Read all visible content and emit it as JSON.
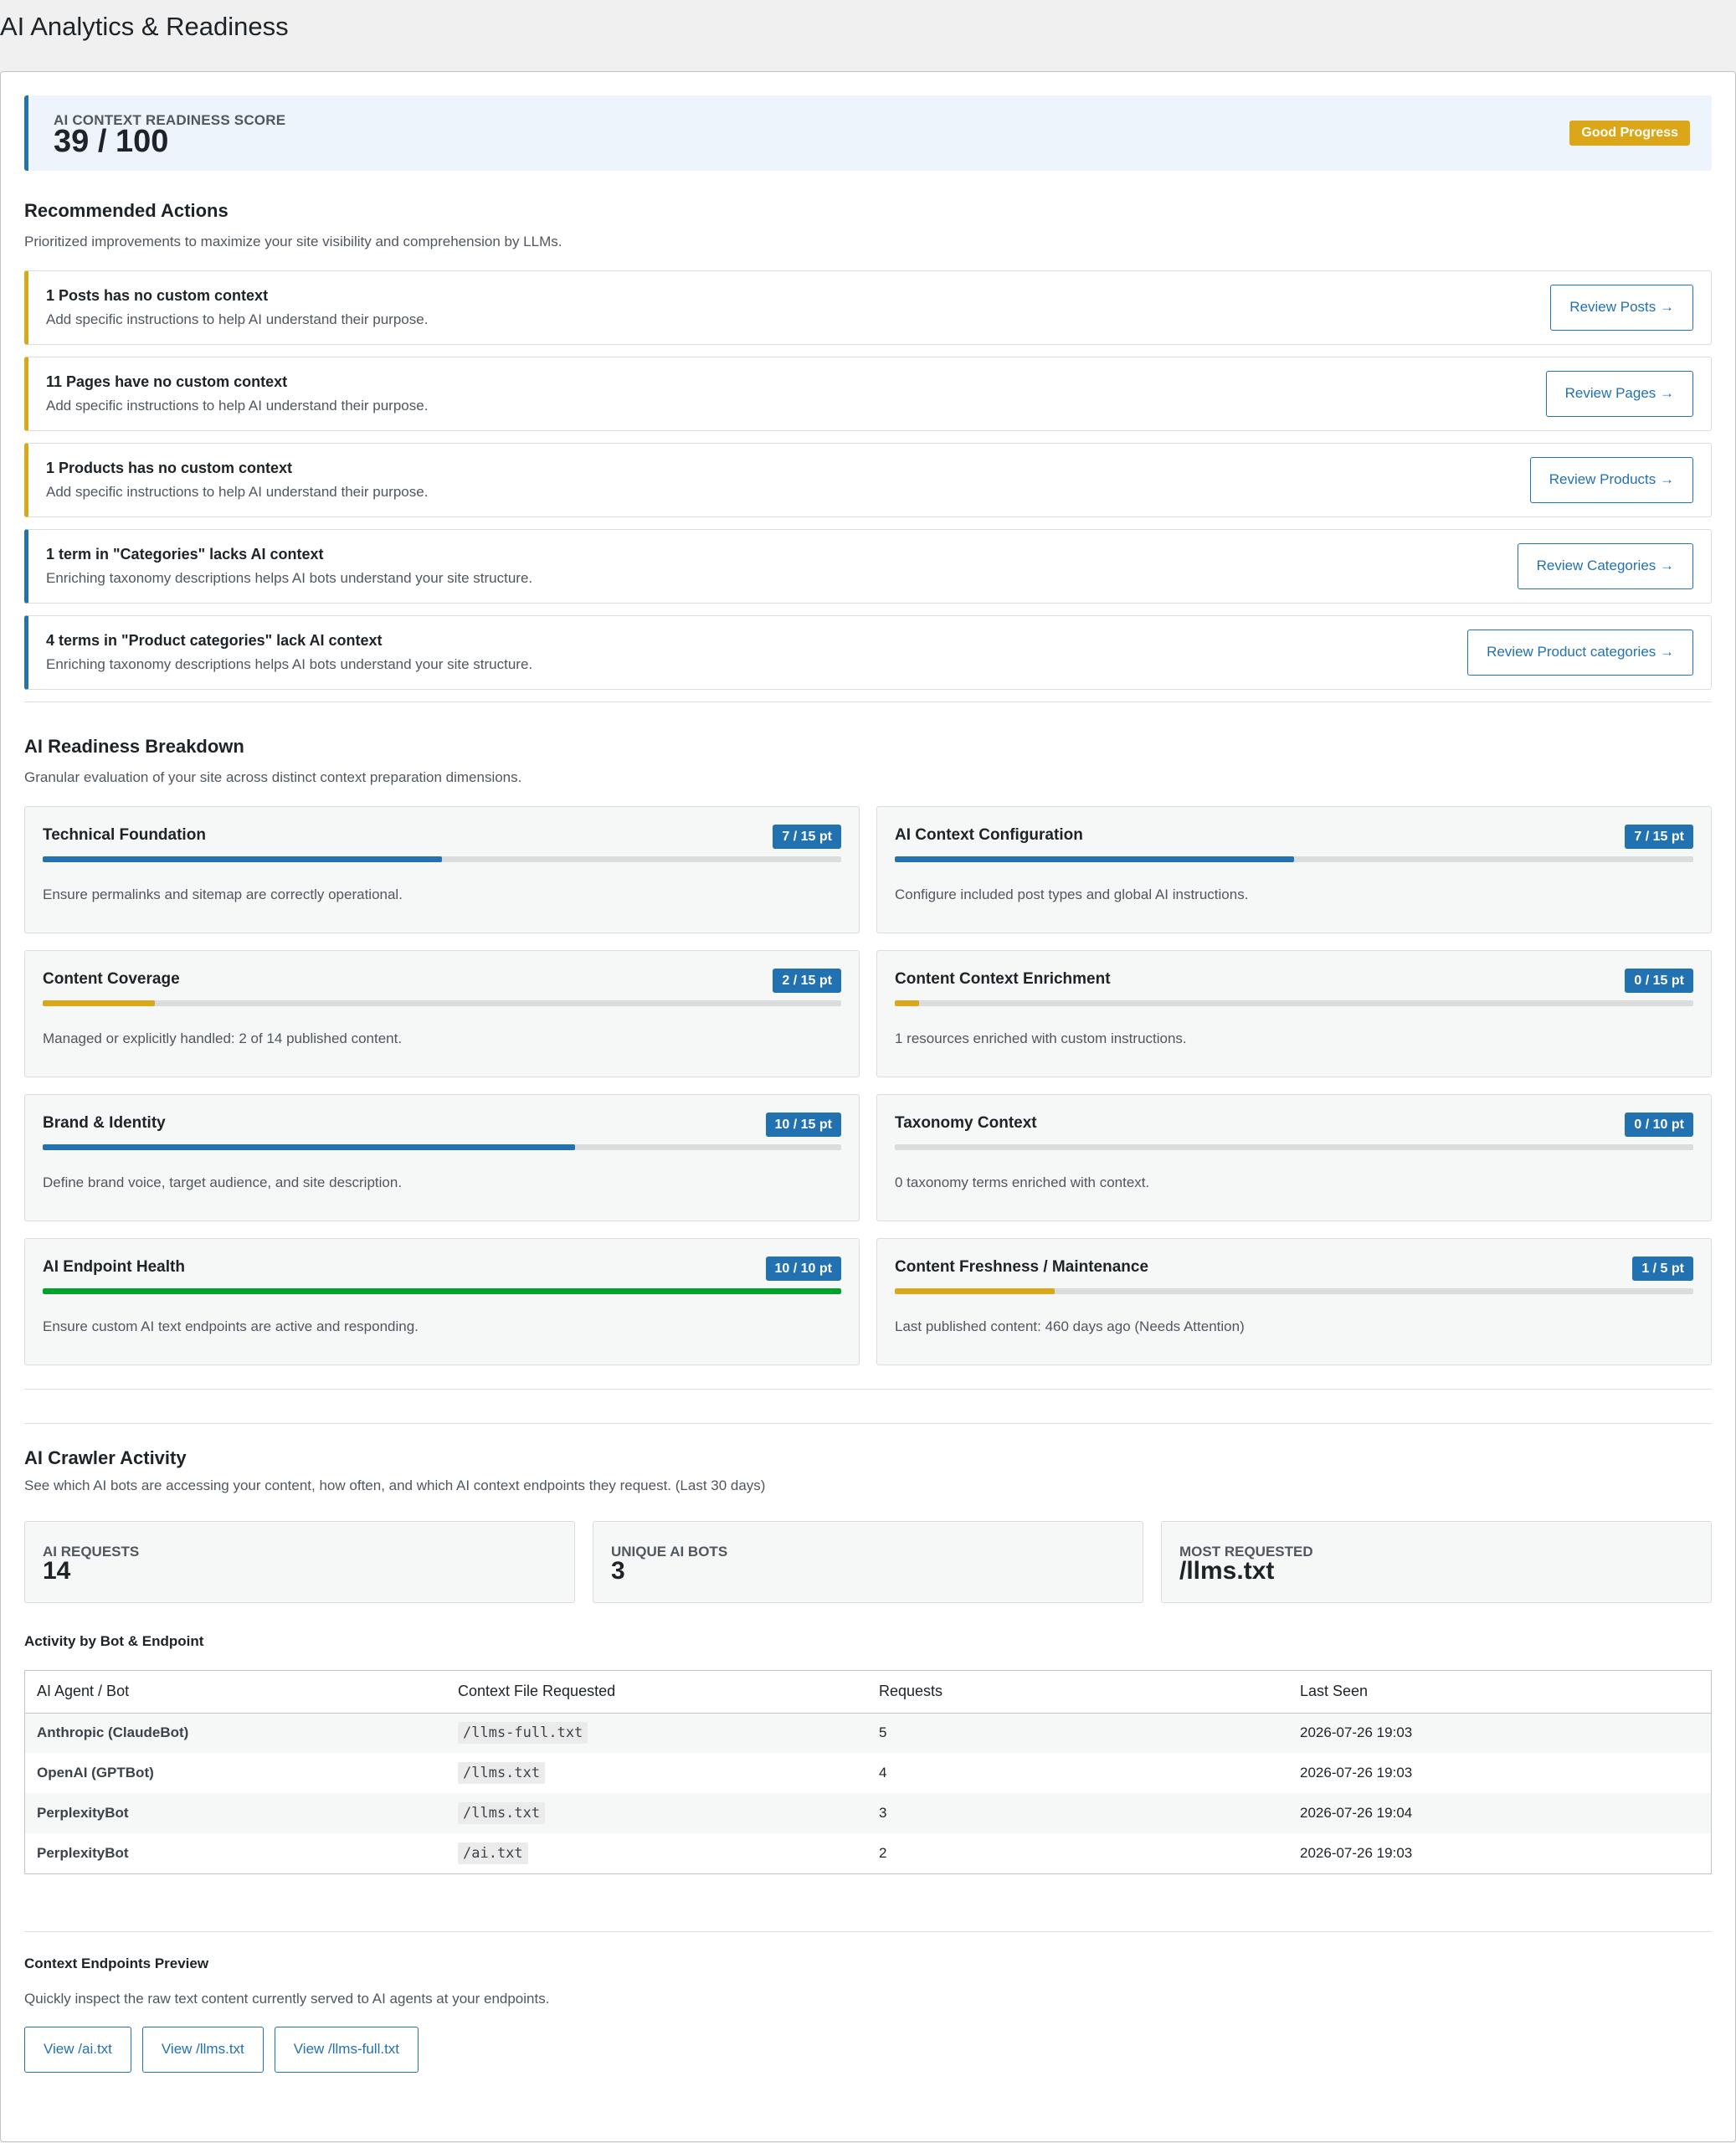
{
  "page_title": "AI Analytics & Readiness",
  "score": {
    "label": "AI CONTEXT READINESS SCORE",
    "value": "39 / 100",
    "badge": "Good Progress",
    "badge_color": "#dba617"
  },
  "recommended": {
    "title": "Recommended Actions",
    "description": "Prioritized improvements to maximize your site visibility and comprehension by LLMs.",
    "items": [
      {
        "title": "1 Posts has no custom context",
        "description": "Add specific instructions to help AI understand their purpose.",
        "button": "Review Posts →",
        "accent": "#dba617"
      },
      {
        "title": "11 Pages have no custom context",
        "description": "Add specific instructions to help AI understand their purpose.",
        "button": "Review Pages →",
        "accent": "#dba617"
      },
      {
        "title": "1 Products has no custom context",
        "description": "Add specific instructions to help AI understand their purpose.",
        "button": "Review Products →",
        "accent": "#dba617"
      },
      {
        "title": "1 term in \"Categories\" lacks AI context",
        "description": "Enriching taxonomy descriptions helps AI bots understand your site structure.",
        "button": "Review Categories →",
        "accent": "#2271b1"
      },
      {
        "title": "4 terms in \"Product categories\" lack AI context",
        "description": "Enriching taxonomy descriptions helps AI bots understand your site structure.",
        "button": "Review Product categories →",
        "accent": "#2271b1"
      }
    ]
  },
  "breakdown": {
    "title": "AI Readiness Breakdown",
    "description": "Granular evaluation of your site across distinct context preparation dimensions.",
    "metrics": [
      {
        "title": "Technical Foundation",
        "badge": "7 / 15 pt",
        "progress": 0.5,
        "bar_color": "#2271b1",
        "description": "Ensure permalinks and sitemap are correctly operational."
      },
      {
        "title": "AI Context Configuration",
        "badge": "7 / 15 pt",
        "progress": 0.5,
        "bar_color": "#2271b1",
        "description": "Configure included post types and global AI instructions."
      },
      {
        "title": "Content Coverage",
        "badge": "2 / 15 pt",
        "progress": 0.14,
        "bar_color": "#dba617",
        "description": "Managed or explicitly handled: 2 of 14 published content."
      },
      {
        "title": "Content Context Enrichment",
        "badge": "0 / 15 pt",
        "progress": 0.03,
        "bar_color": "#dba617",
        "description": "1 resources enriched with custom instructions."
      },
      {
        "title": "Brand & Identity",
        "badge": "10 / 15 pt",
        "progress": 0.667,
        "bar_color": "#2271b1",
        "description": "Define brand voice, target audience, and site description."
      },
      {
        "title": "Taxonomy Context",
        "badge": "0 / 10 pt",
        "progress": 0,
        "bar_color": "#2271b1",
        "description": "0 taxonomy terms enriched with context."
      },
      {
        "title": "AI Endpoint Health",
        "badge": "10 / 10 pt",
        "progress": 1.0,
        "bar_color": "#00a32a",
        "description": "Ensure custom AI text endpoints are active and responding."
      },
      {
        "title": "Content Freshness / Maintenance",
        "badge": "1 / 5 pt",
        "progress": 0.2,
        "bar_color": "#dba617",
        "description": "Last published content: 460 days ago (Needs Attention)"
      }
    ]
  },
  "crawler": {
    "title": "AI Crawler Activity",
    "description": "See which AI bots are accessing your content, how often, and which AI context endpoints they request. (Last 30 days)",
    "stats": [
      {
        "label": "AI REQUESTS",
        "value": "14"
      },
      {
        "label": "UNIQUE AI BOTS",
        "value": "3"
      },
      {
        "label": "MOST REQUESTED",
        "value": "/llms.txt"
      }
    ],
    "activity_title": "Activity by Bot & Endpoint",
    "columns": [
      "AI Agent / Bot",
      "Context File Requested",
      "Requests",
      "Last Seen"
    ],
    "rows": [
      {
        "bot": "Anthropic (ClaudeBot)",
        "file": "/llms-full.txt",
        "requests": "5",
        "last_seen": "2026-07-26 19:03"
      },
      {
        "bot": "OpenAI (GPTBot)",
        "file": "/llms.txt",
        "requests": "4",
        "last_seen": "2026-07-26 19:03"
      },
      {
        "bot": "PerplexityBot",
        "file": "/llms.txt",
        "requests": "3",
        "last_seen": "2026-07-26 19:04"
      },
      {
        "bot": "PerplexityBot",
        "file": "/ai.txt",
        "requests": "2",
        "last_seen": "2026-07-26 19:03"
      }
    ]
  },
  "preview": {
    "title": "Context Endpoints Preview",
    "description": "Quickly inspect the raw text content currently served to AI agents at your endpoints.",
    "buttons": [
      "View /ai.txt",
      "View /llms.txt",
      "View /llms-full.txt"
    ]
  }
}
